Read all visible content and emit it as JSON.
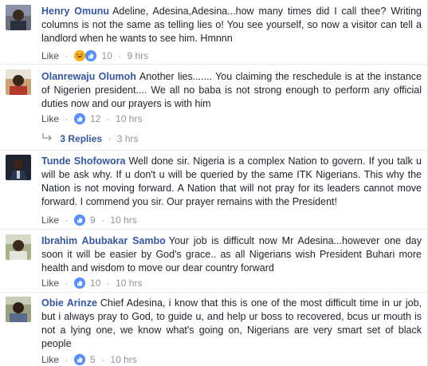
{
  "comments": [
    {
      "author": "Henry Omunu",
      "text": "Adeline, Adesina,Adesina...how many times did I call thee? Writing columns is not the same as telling lies o! You see yourself, so now a visitor can tell a landlord when he wants to see him. Hmnnn",
      "like_label": "Like",
      "reaction_count": "10",
      "time": "9 hrs",
      "reactions": [
        "haha-icon",
        "like-icon"
      ]
    },
    {
      "author": "Olanrewaju Olumoh",
      "text": "Another lies....... You claiming the reschedule is at the instance of Nigerien president.... We all no baba is not strong enough to perform any official duties now and our prayers is with him",
      "like_label": "Like",
      "reaction_count": "12",
      "time": "10 hrs",
      "reactions": [
        "like-icon"
      ],
      "replies_label": "3 Replies",
      "replies_time": "3 hrs"
    },
    {
      "author": "Tunde Shofowora",
      "text": "Well done sir. Nigeria is a complex Nation to govern. If you talk u will be ask why. If u don't u will be queried by the same ITK Nigerians. This why the Nation is not moving forward. A Nation that will not pray for its leaders cannot move forward. I commend you sir. Our prayer remains with the President!",
      "like_label": "Like",
      "reaction_count": "9",
      "time": "10 hrs",
      "reactions": [
        "like-icon"
      ]
    },
    {
      "author": "Ibrahim Abubakar Sambo",
      "text": "Your job is difficult now Mr Adesina...however one day soon it will be easier by God's grace.. as all Nigerians wish President Buhari more health and wisdom to move our dear country forward",
      "like_label": "Like",
      "reaction_count": "10",
      "time": "10 hrs",
      "reactions": [
        "like-icon"
      ]
    },
    {
      "author": "Obie Arinze",
      "text": "Chief Adesina, i know that this is one of the most difficult time in ur job, but i always pray to God, to guide u, and help ur boss to recovered, bcus ur mouth is not a lying one, we know what's going on, Nigerians are very smart set of black people",
      "like_label": "Like",
      "reaction_count": "5",
      "time": "10 hrs",
      "reactions": [
        "like-icon"
      ]
    }
  ],
  "colors": {
    "author": "#365899",
    "meta": "#90949c",
    "like_reaction": "#5890ff",
    "haha_reaction": "#f7b125",
    "divider": "#e9ebee"
  }
}
